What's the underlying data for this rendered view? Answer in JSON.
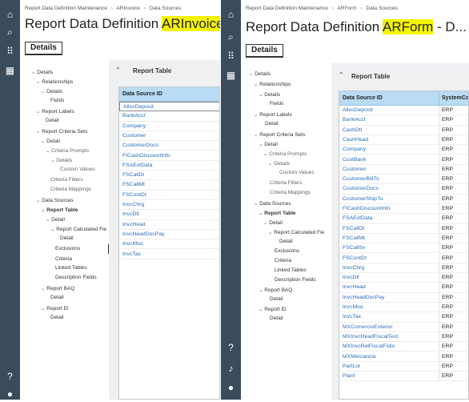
{
  "left_panel": {
    "breadcrumb": [
      "Report Data Definition Maintenance",
      "ARInvoice",
      "Data Sources"
    ],
    "breadcrumb_sep": "›",
    "title_prefix": "Report Data Definition ",
    "title_highlight": "ARInvoice",
    "title_suffix": " -",
    "tab_label": "Details",
    "tree": [
      "Details",
      "Relationships",
      "Details",
      "Fields",
      "Report Labels",
      "Detail",
      "Report Criteria Sets",
      "Detail",
      "Criteria Prompts",
      "Details",
      "Custom Values",
      "Criteria Filters",
      "Criteria Mappings",
      "Data Sources",
      "Report Table",
      "Detail",
      "Report Calculated Fie",
      "Detail",
      "Exclusions",
      "Criteria",
      "Linked Tables",
      "Description Fields",
      "Report BAQ",
      "Detail",
      "Report EI",
      "Detail"
    ],
    "grid_title": "Report Table",
    "column_header": "Data Source ID",
    "rows": [
      "AllocDeposit",
      "BankAcct",
      "Company",
      "Customer",
      "CustomerDocs",
      "FICashDiscountInfo",
      "FSAExtData",
      "FSCallDt",
      "FSCallMt",
      "FSContDt",
      "InvcChrg",
      "InvcDtl",
      "InvcHead",
      "InvcHeadDocPay",
      "InvcMisc",
      "InvcTax"
    ]
  },
  "right_panel": {
    "breadcrumb": [
      "Report Data Definition Maintenance",
      "ARForm",
      "Data Sources"
    ],
    "breadcrumb_sep": "›",
    "title_prefix": "Report Data Definition ",
    "title_highlight": "ARForm",
    "title_suffix": " - D...",
    "tab_label": "Details",
    "tree": [
      "Details",
      "Relationships",
      "Details",
      "Fields",
      "Report Labels",
      "Detail",
      "Report Criteria Sets",
      "Detail",
      "Criteria Prompts",
      "Details",
      "Custom Values",
      "Criteria Filters",
      "Criteria Mappings",
      "Data Sources",
      "Report Table",
      "Detail",
      "Report Calculated Fie",
      "Detail",
      "Exclusions",
      "Criteria",
      "Linked Tables",
      "Description Fields",
      "Report BAQ",
      "Detail",
      "Report EI",
      "Detail"
    ],
    "grid_title": "Report Table",
    "column_header": "Data Source ID",
    "column_header_2": "SystemCod",
    "rows": [
      "AllocDeposit",
      "BankAcct",
      "CashDtl",
      "CashHead",
      "Company",
      "CustBank",
      "Customer",
      "CustomerBillTo",
      "CustomerDocs",
      "CustomerShipTo",
      "FICashDiscountInfo",
      "FSAExtData",
      "FSCallDt",
      "FSCallMt",
      "FSCallSv",
      "FSContDt",
      "InvcChrg",
      "InvcDtl",
      "InvcHead",
      "InvcHeadDocPay",
      "InvcMisc",
      "InvcTax",
      "MXComercioExterior",
      "MXInvcHeadFiscalText",
      "MXInvcRelFiscalFolio",
      "MXMercancia",
      "PartLot",
      "Plant"
    ],
    "system_code": "ERP"
  },
  "icons": {
    "nav": [
      "home-icon",
      "search-icon",
      "apps-grid-icon",
      "dashboard-icon"
    ],
    "bottom": [
      "help-icon",
      "notification-icon",
      "user-icon"
    ]
  }
}
